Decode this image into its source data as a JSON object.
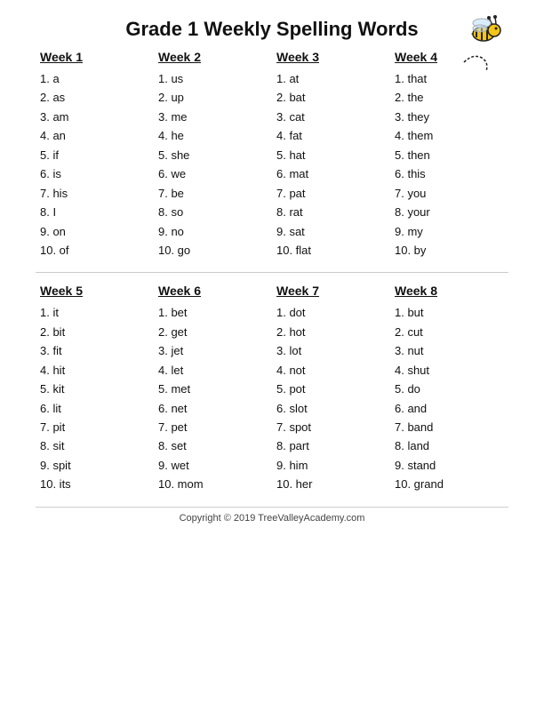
{
  "title": "Grade 1 Weekly Spelling Words",
  "sections": [
    {
      "weeks": [
        {
          "label": "Week 1",
          "words": [
            "1.  a",
            "2.  as",
            "3.  am",
            "4.  an",
            "5.  if",
            "6.  is",
            "7.  his",
            "8.  I",
            "9.  on",
            "10. of"
          ]
        },
        {
          "label": "Week 2",
          "words": [
            "1.  us",
            "2.  up",
            "3.  me",
            "4.  he",
            "5.  she",
            "6.  we",
            "7.  be",
            "8.  so",
            "9.  no",
            "10. go"
          ]
        },
        {
          "label": "Week 3",
          "words": [
            "1.  at",
            "2.  bat",
            "3.  cat",
            "4.  fat",
            "5.  hat",
            "6.  mat",
            "7.  pat",
            "8.  rat",
            "9.  sat",
            "10. flat"
          ]
        },
        {
          "label": "Week 4",
          "words": [
            "1.  that",
            "2.  the",
            "3.  they",
            "4.  them",
            "5.  then",
            "6.  this",
            "7.  you",
            "8.  your",
            "9.  my",
            "10. by"
          ]
        }
      ]
    },
    {
      "weeks": [
        {
          "label": "Week 5",
          "words": [
            "1.  it",
            "2.  bit",
            "3.  fit",
            "4.  hit",
            "5.  kit",
            "6.  lit",
            "7.  pit",
            "8.  sit",
            "9.  spit",
            "10. its"
          ]
        },
        {
          "label": "Week 6",
          "words": [
            "1.  bet",
            "2.  get",
            "3.  jet",
            "4.  let",
            "5.  met",
            "6.  net",
            "7.  pet",
            "8.  set",
            "9.  wet",
            "10. mom"
          ]
        },
        {
          "label": "Week 7",
          "words": [
            "1.  dot",
            "2.  hot",
            "3.  lot",
            "4.  not",
            "5.  pot",
            "6.  slot",
            "7.  spot",
            "8.  part",
            "9.  him",
            "10. her"
          ]
        },
        {
          "label": "Week 8",
          "words": [
            "1.  but",
            "2.  cut",
            "3.  nut",
            "4.  shut",
            "5.  do",
            "6.  and",
            "7.  band",
            "8.  land",
            "9.  stand",
            "10. grand"
          ]
        }
      ]
    }
  ],
  "footer": "Copyright © 2019 TreeValleyAcademy.com"
}
